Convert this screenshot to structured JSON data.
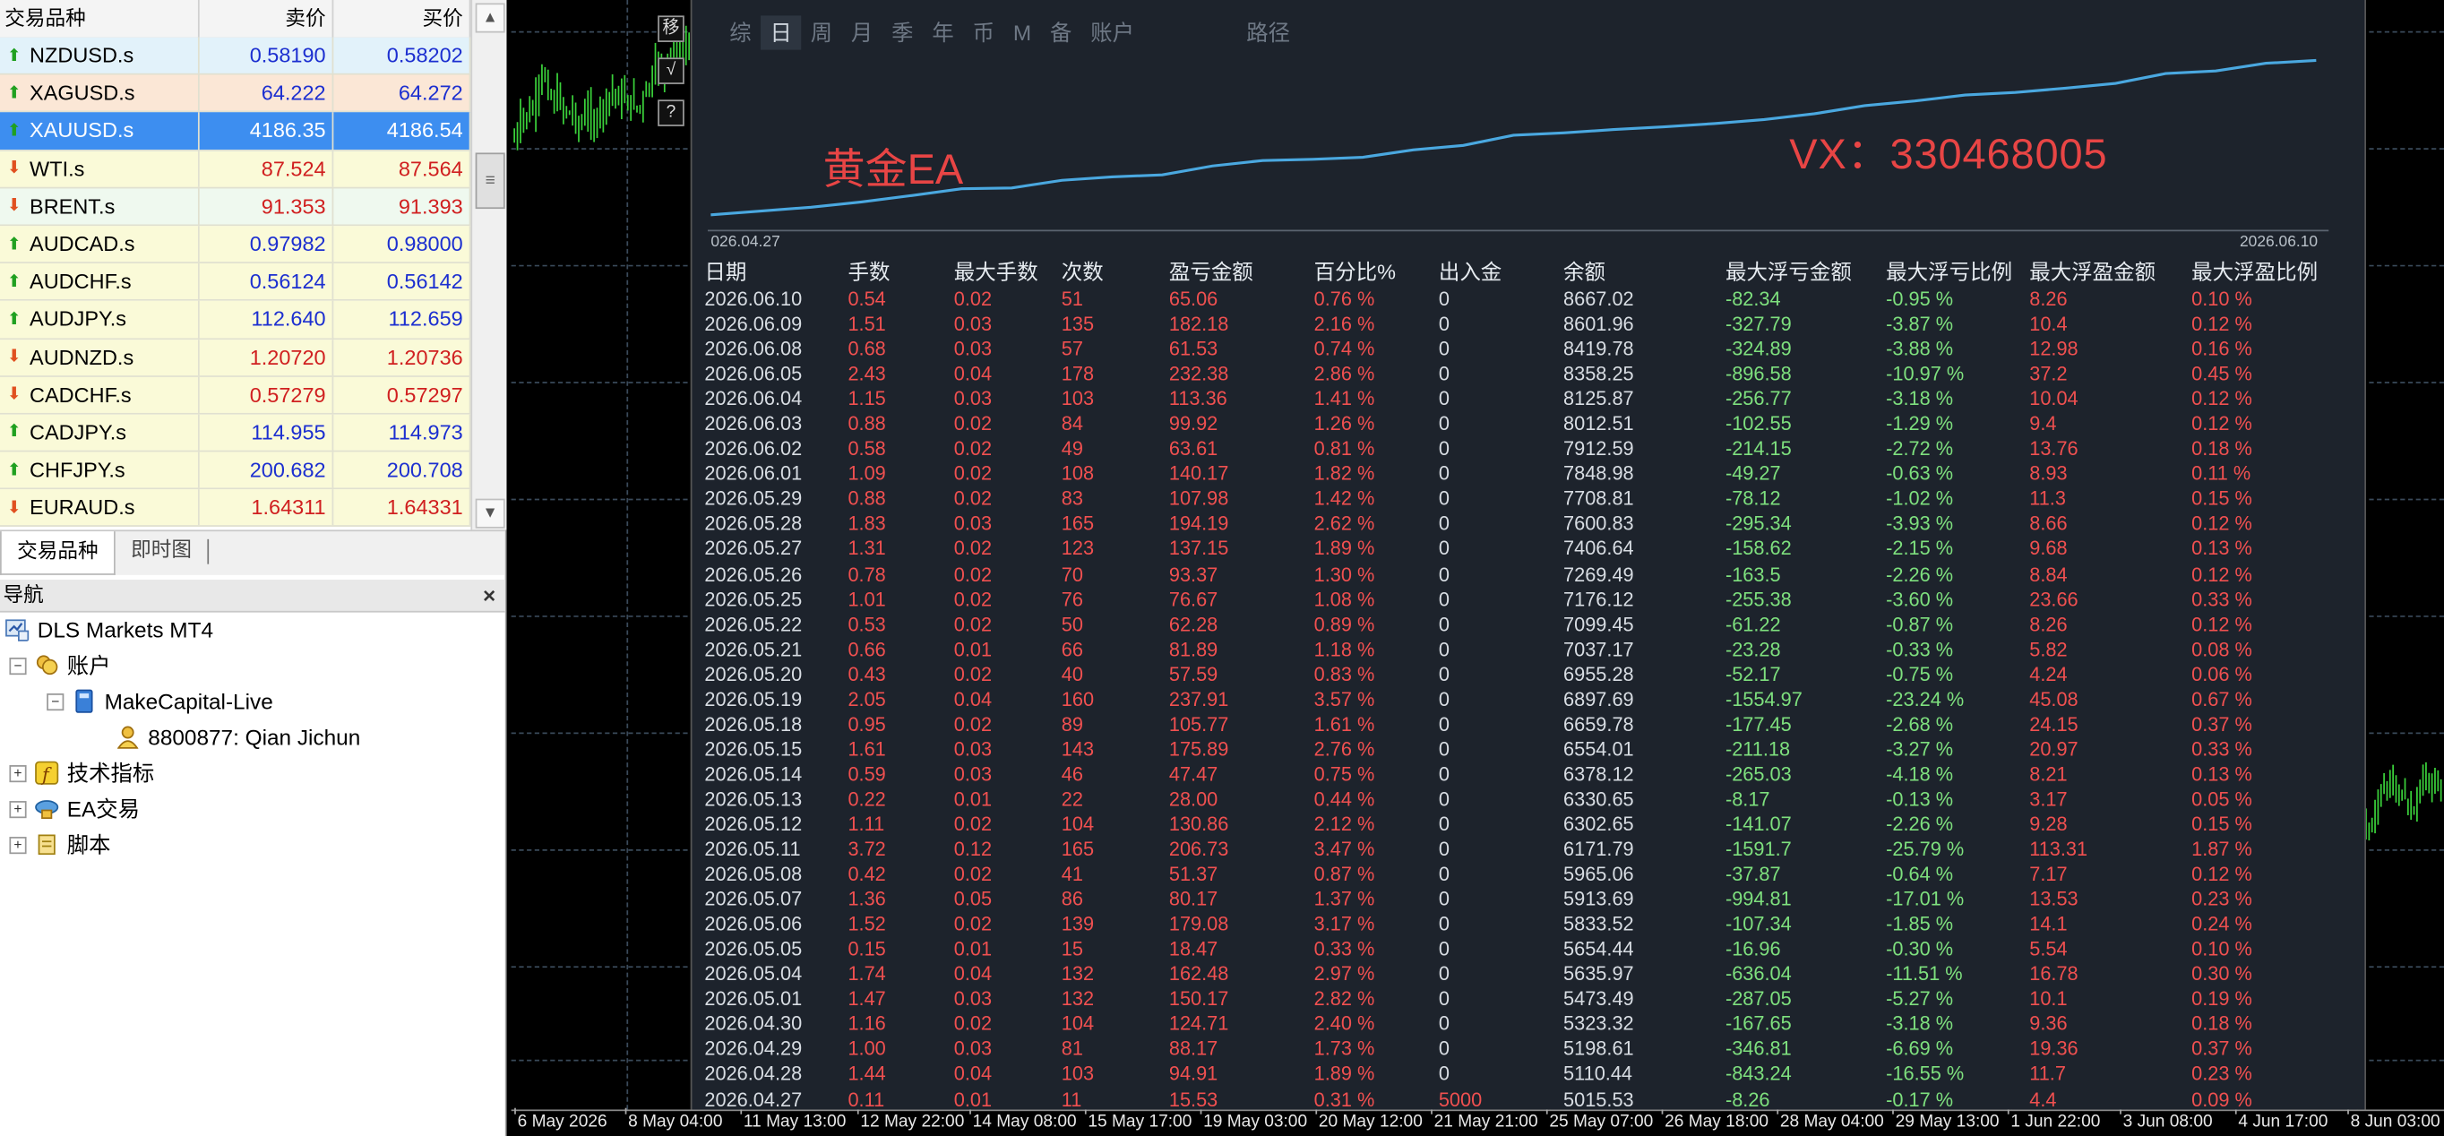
{
  "market_watch": {
    "col_symbol": "交易品种",
    "col_bid": "卖价",
    "col_ask": "买价",
    "rows": [
      {
        "symbol": "NZDUSD.s",
        "bid": "0.58190",
        "ask": "0.58202",
        "dir": "up",
        "color": "blue",
        "bg": "#e2f2fa"
      },
      {
        "symbol": "XAGUSD.s",
        "bid": "64.222",
        "ask": "64.272",
        "dir": "up",
        "color": "blue",
        "bg": "#fbe7d6"
      },
      {
        "symbol": "XAUUSD.s",
        "bid": "4186.35",
        "ask": "4186.54",
        "dir": "up",
        "color": "blue",
        "bg": "#3d8ef0",
        "selected": true
      },
      {
        "symbol": "WTI.s",
        "bid": "87.524",
        "ask": "87.564",
        "dir": "down",
        "color": "red",
        "bg": "#fafad8"
      },
      {
        "symbol": "BRENT.s",
        "bid": "91.353",
        "ask": "91.393",
        "dir": "down",
        "color": "red",
        "bg": "#eff9ef"
      },
      {
        "symbol": "AUDCAD.s",
        "bid": "0.97982",
        "ask": "0.98000",
        "dir": "up",
        "color": "blue",
        "bg": "#fafad8"
      },
      {
        "symbol": "AUDCHF.s",
        "bid": "0.56124",
        "ask": "0.56142",
        "dir": "up",
        "color": "blue",
        "bg": "#fafad8"
      },
      {
        "symbol": "AUDJPY.s",
        "bid": "112.640",
        "ask": "112.659",
        "dir": "up",
        "color": "blue",
        "bg": "#fafad8"
      },
      {
        "symbol": "AUDNZD.s",
        "bid": "1.20720",
        "ask": "1.20736",
        "dir": "down",
        "color": "red",
        "bg": "#fafad8"
      },
      {
        "symbol": "CADCHF.s",
        "bid": "0.57279",
        "ask": "0.57297",
        "dir": "down",
        "color": "red",
        "bg": "#fafad8"
      },
      {
        "symbol": "CADJPY.s",
        "bid": "114.955",
        "ask": "114.973",
        "dir": "up",
        "color": "blue",
        "bg": "#fafad8"
      },
      {
        "symbol": "CHFJPY.s",
        "bid": "200.682",
        "ask": "200.708",
        "dir": "up",
        "color": "blue",
        "bg": "#fafad8"
      },
      {
        "symbol": "EURAUD.s",
        "bid": "1.64311",
        "ask": "1.64331",
        "dir": "down",
        "color": "red",
        "bg": "#fafad8"
      }
    ],
    "tab_symbols": "交易品种",
    "tab_tick": "即时图"
  },
  "navigator": {
    "title": "导航",
    "close": "×",
    "broker": "DLS Markets MT4",
    "accounts": "账户",
    "server": "MakeCapital-Live",
    "account": "8800877: Qian Jichun",
    "indicators": "技术指标",
    "experts": "EA交易",
    "scripts": "脚本"
  },
  "chart": {
    "tool_move": "移",
    "tool_check": "√",
    "tool_help": "?",
    "time_labels": [
      "6 May 2026",
      "8 May 04:00",
      "11 May 13:00",
      "12 May 22:00",
      "14 May 08:00",
      "15 May 17:00",
      "19 May 03:00",
      "20 May 12:00",
      "21 May 21:00",
      "25 May 07:00",
      "26 May 18:00",
      "28 May 04:00",
      "29 May 13:00",
      "1 Jun 22:00",
      "3 Jun 08:00",
      "4 Jun 17:00",
      "8 Jun 03:00"
    ]
  },
  "ea_panel": {
    "tabs": [
      "综",
      "日",
      "周",
      "月",
      "季",
      "年",
      "币",
      "M",
      "备",
      "账户"
    ],
    "active_tab": "日",
    "path_label": "路径",
    "ea_label": "黄金EA",
    "vx_label": "VX：330468005",
    "date_start": "026.04.27",
    "date_end": "2026.06.10",
    "curve_color": "#4aa8e0",
    "headers": [
      "日期",
      "手数",
      "最大手数",
      "次数",
      "盈亏金额",
      "百分比%",
      "出入金",
      "余额",
      "最大浮亏金额",
      "最大浮亏比例",
      "最大浮盈金额",
      "最大浮盈比例"
    ],
    "rows": [
      [
        "2026.06.10",
        "0.54",
        "0.02",
        "51",
        "65.06",
        "0.76 %",
        "0",
        "8667.02",
        "-82.34",
        "-0.95 %",
        "8.26",
        "0.10 %"
      ],
      [
        "2026.06.09",
        "1.51",
        "0.03",
        "135",
        "182.18",
        "2.16 %",
        "0",
        "8601.96",
        "-327.79",
        "-3.87 %",
        "10.4",
        "0.12 %"
      ],
      [
        "2026.06.08",
        "0.68",
        "0.03",
        "57",
        "61.53",
        "0.74 %",
        "0",
        "8419.78",
        "-324.89",
        "-3.88 %",
        "12.98",
        "0.16 %"
      ],
      [
        "2026.06.05",
        "2.43",
        "0.04",
        "178",
        "232.38",
        "2.86 %",
        "0",
        "8358.25",
        "-896.58",
        "-10.97 %",
        "37.2",
        "0.45 %"
      ],
      [
        "2026.06.04",
        "1.15",
        "0.03",
        "103",
        "113.36",
        "1.41 %",
        "0",
        "8125.87",
        "-256.77",
        "-3.18 %",
        "10.04",
        "0.12 %"
      ],
      [
        "2026.06.03",
        "0.88",
        "0.02",
        "84",
        "99.92",
        "1.26 %",
        "0",
        "8012.51",
        "-102.55",
        "-1.29 %",
        "9.4",
        "0.12 %"
      ],
      [
        "2026.06.02",
        "0.58",
        "0.02",
        "49",
        "63.61",
        "0.81 %",
        "0",
        "7912.59",
        "-214.15",
        "-2.72 %",
        "13.76",
        "0.18 %"
      ],
      [
        "2026.06.01",
        "1.09",
        "0.02",
        "108",
        "140.17",
        "1.82 %",
        "0",
        "7848.98",
        "-49.27",
        "-0.63 %",
        "8.93",
        "0.11 %"
      ],
      [
        "2026.05.29",
        "0.88",
        "0.02",
        "83",
        "107.98",
        "1.42 %",
        "0",
        "7708.81",
        "-78.12",
        "-1.02 %",
        "11.3",
        "0.15 %"
      ],
      [
        "2026.05.28",
        "1.83",
        "0.03",
        "165",
        "194.19",
        "2.62 %",
        "0",
        "7600.83",
        "-295.34",
        "-3.93 %",
        "8.66",
        "0.12 %"
      ],
      [
        "2026.05.27",
        "1.31",
        "0.02",
        "123",
        "137.15",
        "1.89 %",
        "0",
        "7406.64",
        "-158.62",
        "-2.15 %",
        "9.68",
        "0.13 %"
      ],
      [
        "2026.05.26",
        "0.78",
        "0.02",
        "70",
        "93.37",
        "1.30 %",
        "0",
        "7269.49",
        "-163.5",
        "-2.26 %",
        "8.84",
        "0.12 %"
      ],
      [
        "2026.05.25",
        "1.01",
        "0.02",
        "76",
        "76.67",
        "1.08 %",
        "0",
        "7176.12",
        "-255.38",
        "-3.60 %",
        "23.66",
        "0.33 %"
      ],
      [
        "2026.05.22",
        "0.53",
        "0.02",
        "50",
        "62.28",
        "0.89 %",
        "0",
        "7099.45",
        "-61.22",
        "-0.87 %",
        "8.26",
        "0.12 %"
      ],
      [
        "2026.05.21",
        "0.66",
        "0.01",
        "66",
        "81.89",
        "1.18 %",
        "0",
        "7037.17",
        "-23.28",
        "-0.33 %",
        "5.82",
        "0.08 %"
      ],
      [
        "2026.05.20",
        "0.43",
        "0.02",
        "40",
        "57.59",
        "0.83 %",
        "0",
        "6955.28",
        "-52.17",
        "-0.75 %",
        "4.24",
        "0.06 %"
      ],
      [
        "2026.05.19",
        "2.05",
        "0.04",
        "160",
        "237.91",
        "3.57 %",
        "0",
        "6897.69",
        "-1554.97",
        "-23.24 %",
        "45.08",
        "0.67 %"
      ],
      [
        "2026.05.18",
        "0.95",
        "0.02",
        "89",
        "105.77",
        "1.61 %",
        "0",
        "6659.78",
        "-177.45",
        "-2.68 %",
        "24.15",
        "0.37 %"
      ],
      [
        "2026.05.15",
        "1.61",
        "0.03",
        "143",
        "175.89",
        "2.76 %",
        "0",
        "6554.01",
        "-211.18",
        "-3.27 %",
        "20.97",
        "0.33 %"
      ],
      [
        "2026.05.14",
        "0.59",
        "0.03",
        "46",
        "47.47",
        "0.75 %",
        "0",
        "6378.12",
        "-265.03",
        "-4.18 %",
        "8.21",
        "0.13 %"
      ],
      [
        "2026.05.13",
        "0.22",
        "0.01",
        "22",
        "28.00",
        "0.44 %",
        "0",
        "6330.65",
        "-8.17",
        "-0.13 %",
        "3.17",
        "0.05 %"
      ],
      [
        "2026.05.12",
        "1.11",
        "0.02",
        "104",
        "130.86",
        "2.12 %",
        "0",
        "6302.65",
        "-141.07",
        "-2.26 %",
        "9.28",
        "0.15 %"
      ],
      [
        "2026.05.11",
        "3.72",
        "0.12",
        "165",
        "206.73",
        "3.47 %",
        "0",
        "6171.79",
        "-1591.7",
        "-25.79 %",
        "113.31",
        "1.87 %"
      ],
      [
        "2026.05.08",
        "0.42",
        "0.02",
        "41",
        "51.37",
        "0.87 %",
        "0",
        "5965.06",
        "-37.87",
        "-0.64 %",
        "7.17",
        "0.12 %"
      ],
      [
        "2026.05.07",
        "1.36",
        "0.05",
        "86",
        "80.17",
        "1.37 %",
        "0",
        "5913.69",
        "-994.81",
        "-17.01 %",
        "13.53",
        "0.23 %"
      ],
      [
        "2026.05.06",
        "1.52",
        "0.02",
        "139",
        "179.08",
        "3.17 %",
        "0",
        "5833.52",
        "-107.34",
        "-1.85 %",
        "14.1",
        "0.24 %"
      ],
      [
        "2026.05.05",
        "0.15",
        "0.01",
        "15",
        "18.47",
        "0.33 %",
        "0",
        "5654.44",
        "-16.96",
        "-0.30 %",
        "5.54",
        "0.10 %"
      ],
      [
        "2026.05.04",
        "1.74",
        "0.04",
        "132",
        "162.48",
        "2.97 %",
        "0",
        "5635.97",
        "-636.04",
        "-11.51 %",
        "16.78",
        "0.30 %"
      ],
      [
        "2026.05.01",
        "1.47",
        "0.03",
        "132",
        "150.17",
        "2.82 %",
        "0",
        "5473.49",
        "-287.05",
        "-5.27 %",
        "10.1",
        "0.19 %"
      ],
      [
        "2026.04.30",
        "1.16",
        "0.02",
        "104",
        "124.71",
        "2.40 %",
        "0",
        "5323.32",
        "-167.65",
        "-3.18 %",
        "9.36",
        "0.18 %"
      ],
      [
        "2026.04.29",
        "1.00",
        "0.03",
        "81",
        "88.17",
        "1.73 %",
        "0",
        "5198.61",
        "-346.81",
        "-6.69 %",
        "19.36",
        "0.37 %"
      ],
      [
        "2026.04.28",
        "1.44",
        "0.04",
        "103",
        "94.91",
        "1.89 %",
        "0",
        "5110.44",
        "-843.24",
        "-16.55 %",
        "11.7",
        "0.23 %"
      ],
      [
        "2026.04.27",
        "0.11",
        "0.01",
        "11",
        "15.53",
        "0.31 %",
        "5000",
        "5015.53",
        "-8.26",
        "-0.17 %",
        "4.4",
        "0.09 %"
      ]
    ]
  }
}
